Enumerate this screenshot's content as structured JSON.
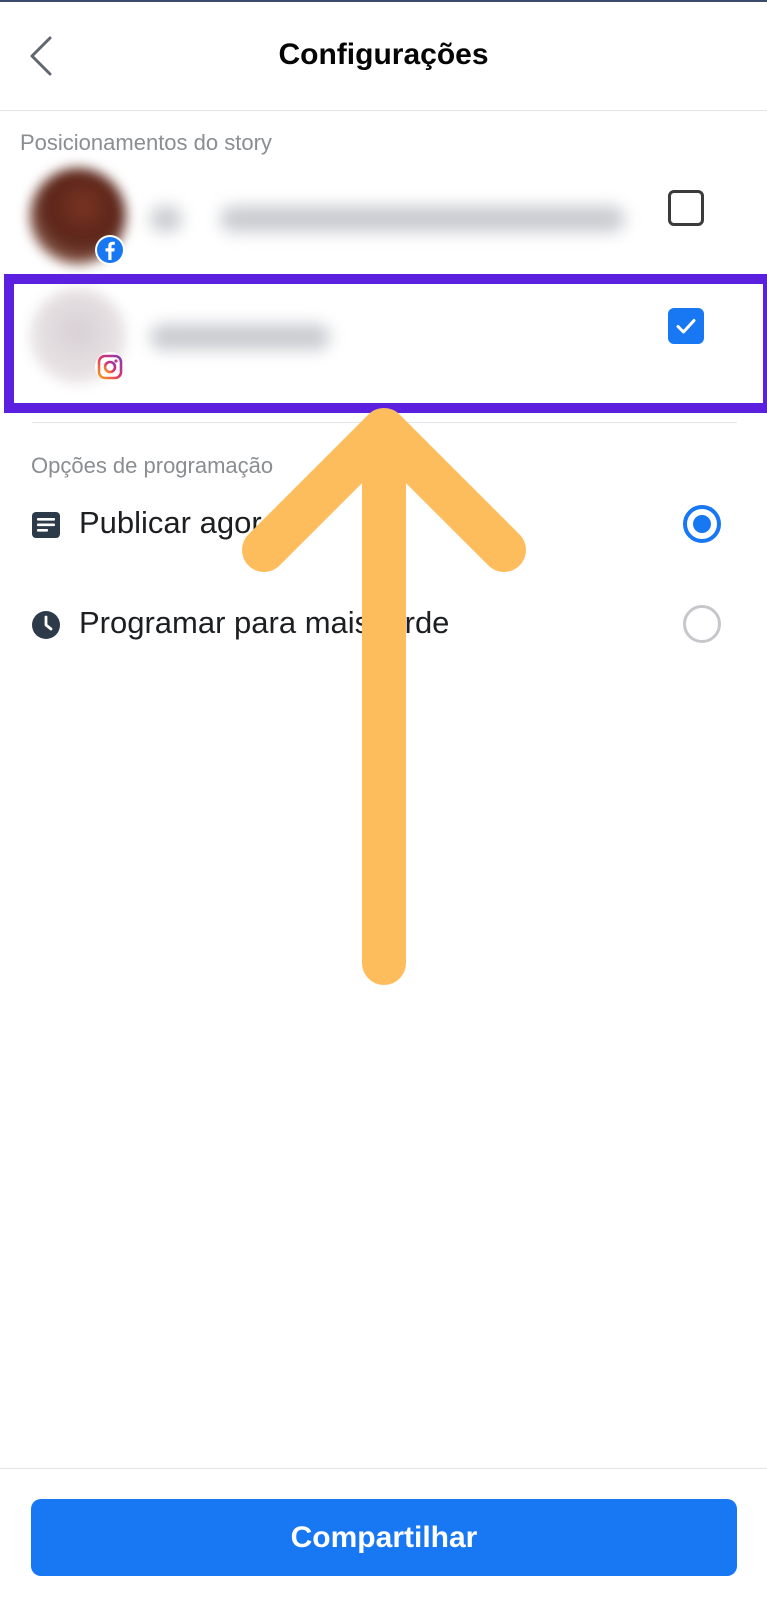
{
  "header": {
    "title": "Configurações",
    "back_icon": "chevron-left-icon"
  },
  "story_placements": {
    "label": "Posicionamentos do story",
    "accounts": [
      {
        "platform": "facebook",
        "platform_icon": "facebook-icon",
        "checked": false
      },
      {
        "platform": "instagram",
        "platform_icon": "instagram-icon",
        "checked": true
      }
    ]
  },
  "schedule": {
    "label": "Opções de programação",
    "options": [
      {
        "label": "Publicar agora",
        "icon": "document-icon",
        "selected": true
      },
      {
        "label": "Programar para mais tarde",
        "icon": "clock-icon",
        "selected": false
      }
    ]
  },
  "annotation": {
    "highlight_color": "#5b1fe0",
    "arrow_color": "#fdbd5c"
  },
  "footer": {
    "share_label": "Compartilhar"
  },
  "colors": {
    "accent": "#1877f2",
    "text": "#1c1e21",
    "muted": "#8a8d91"
  }
}
